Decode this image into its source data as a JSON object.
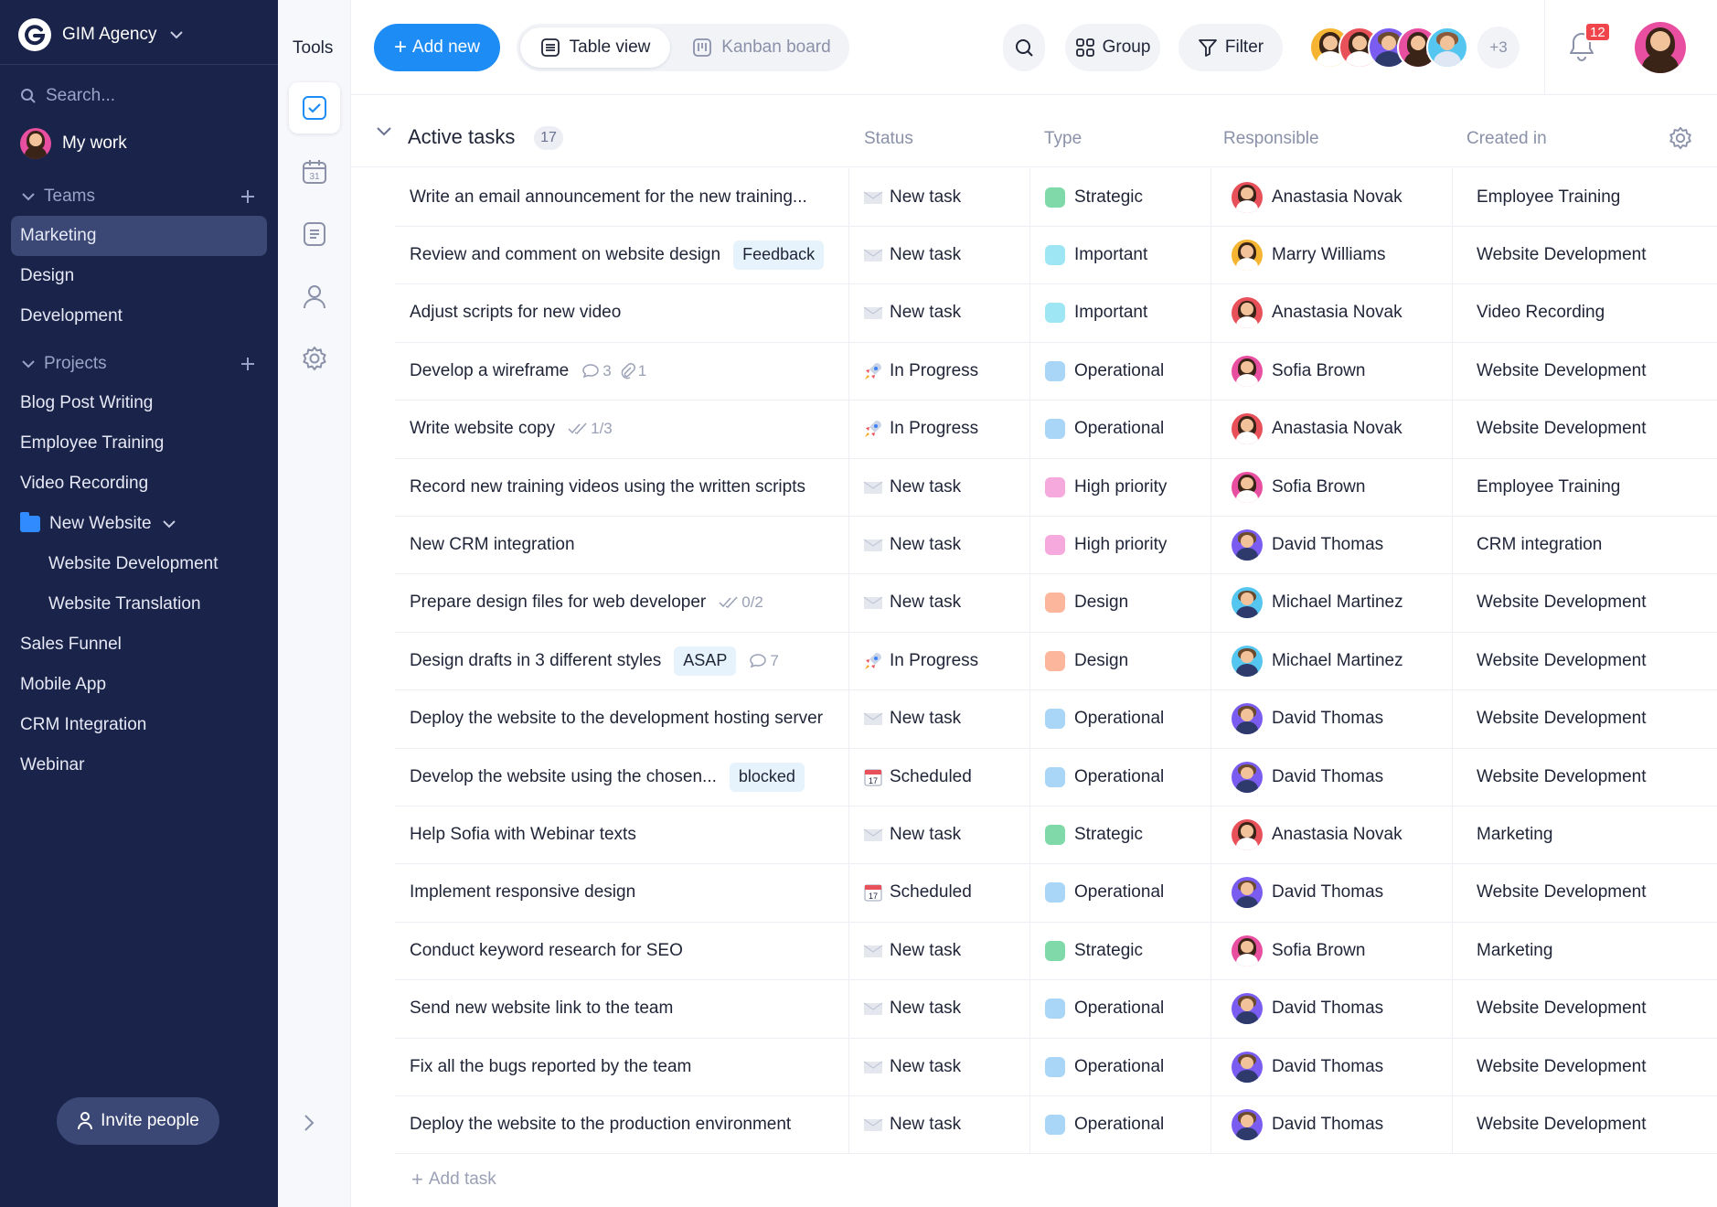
{
  "sidebar": {
    "org_name": "GIM Agency",
    "search_placeholder": "Search...",
    "my_work": "My work",
    "teams_label": "Teams",
    "teams": [
      "Marketing",
      "Design",
      "Development"
    ],
    "active_team": "Marketing",
    "projects_label": "Projects",
    "projects": [
      "Blog Post Writing",
      "Employee Training",
      "Video Recording"
    ],
    "folder": "New Website",
    "folder_items": [
      "Website Development",
      "Website Translation"
    ],
    "projects_after": [
      "Sales Funnel",
      "Mobile App",
      "CRM Integration",
      "Webinar"
    ],
    "invite": "Invite people"
  },
  "tools": {
    "title": "Tools",
    "calendar_day": "31"
  },
  "topbar": {
    "add_new": "Add new",
    "table_view": "Table view",
    "kanban_board": "Kanban board",
    "group": "Group",
    "filter": "Filter",
    "more_members": "+3",
    "notifications_count": "12"
  },
  "table": {
    "group_title": "Active tasks",
    "group_count": "17",
    "columns": [
      "Status",
      "Type",
      "Responsible",
      "Created in"
    ],
    "add_task": "Add task",
    "rows": [
      {
        "task": "Write an email announcement for the new training...",
        "status": "New task",
        "type": "Strategic",
        "responsible": "Anastasia Novak",
        "created_in": "Employee Training"
      },
      {
        "task": "Review and comment on website design",
        "tag": "Feedback",
        "status": "New task",
        "type": "Important",
        "responsible": "Marry Williams",
        "created_in": "Website Development"
      },
      {
        "task": "Adjust scripts for new video",
        "status": "New task",
        "type": "Important",
        "responsible": "Anastasia Novak",
        "created_in": "Video Recording"
      },
      {
        "task": "Develop a wireframe",
        "comments": "3",
        "attachments": "1",
        "status": "In Progress",
        "type": "Operational",
        "responsible": "Sofia Brown",
        "created_in": "Website Development"
      },
      {
        "task": "Write website copy",
        "checklist": "1/3",
        "status": "In Progress",
        "type": "Operational",
        "responsible": "Anastasia Novak",
        "created_in": "Website Development"
      },
      {
        "task": "Record new training videos using the written scripts",
        "status": "New task",
        "type": "High priority",
        "responsible": "Sofia Brown",
        "created_in": "Employee Training"
      },
      {
        "task": "New CRM integration",
        "status": "New task",
        "type": "High priority",
        "responsible": "David Thomas",
        "created_in": "CRM integration"
      },
      {
        "task": "Prepare design files for web developer",
        "checklist": "0/2",
        "status": "New task",
        "type": "Design",
        "responsible": "Michael Martinez",
        "created_in": "Website Development"
      },
      {
        "task": "Design drafts in 3 different styles",
        "tag": "ASAP",
        "comments": "7",
        "status": "In Progress",
        "type": "Design",
        "responsible": "Michael Martinez",
        "created_in": "Website Development"
      },
      {
        "task": "Deploy the website to the development hosting server",
        "status": "New task",
        "type": "Operational",
        "responsible": "David Thomas",
        "created_in": "Website Development"
      },
      {
        "task": "Develop the website using the chosen...",
        "tag": "blocked",
        "status": "Scheduled",
        "type": "Operational",
        "responsible": "David Thomas",
        "created_in": "Website Development"
      },
      {
        "task": "Help Sofia with Webinar texts",
        "status": "New task",
        "type": "Strategic",
        "responsible": "Anastasia Novak",
        "created_in": "Marketing"
      },
      {
        "task": "Implement responsive design",
        "status": "Scheduled",
        "type": "Operational",
        "responsible": "David Thomas",
        "created_in": "Website Development"
      },
      {
        "task": "Conduct keyword research for SEO",
        "status": "New task",
        "type": "Strategic",
        "responsible": "Sofia Brown",
        "created_in": "Marketing"
      },
      {
        "task": "Send new website link to the team",
        "status": "New task",
        "type": "Operational",
        "responsible": "David Thomas",
        "created_in": "Website Development"
      },
      {
        "task": "Fix all the bugs reported by the team",
        "status": "New task",
        "type": "Operational",
        "responsible": "David Thomas",
        "created_in": "Website Development"
      },
      {
        "task": "Deploy the website to the production environment",
        "status": "New task",
        "type": "Operational",
        "responsible": "David Thomas",
        "created_in": "Website Development"
      }
    ]
  },
  "colors": {
    "sidebar_bg": "#1a2349",
    "accent": "#1e8cf5",
    "notification": "#f0464b",
    "type_colors": {
      "Strategic": "#7fd9a8",
      "Important": "#9fe6f5",
      "Operational": "#a9d6f7",
      "High priority": "#f5a9dc",
      "Design": "#fbb69c"
    },
    "avatar_colors": {
      "Anastasia Novak": "#e8515a",
      "Marry Williams": "#f5b431",
      "Sofia Brown": "#e94fa0",
      "David Thomas": "#7a5cf0",
      "Michael Martinez": "#55c6ef"
    }
  }
}
